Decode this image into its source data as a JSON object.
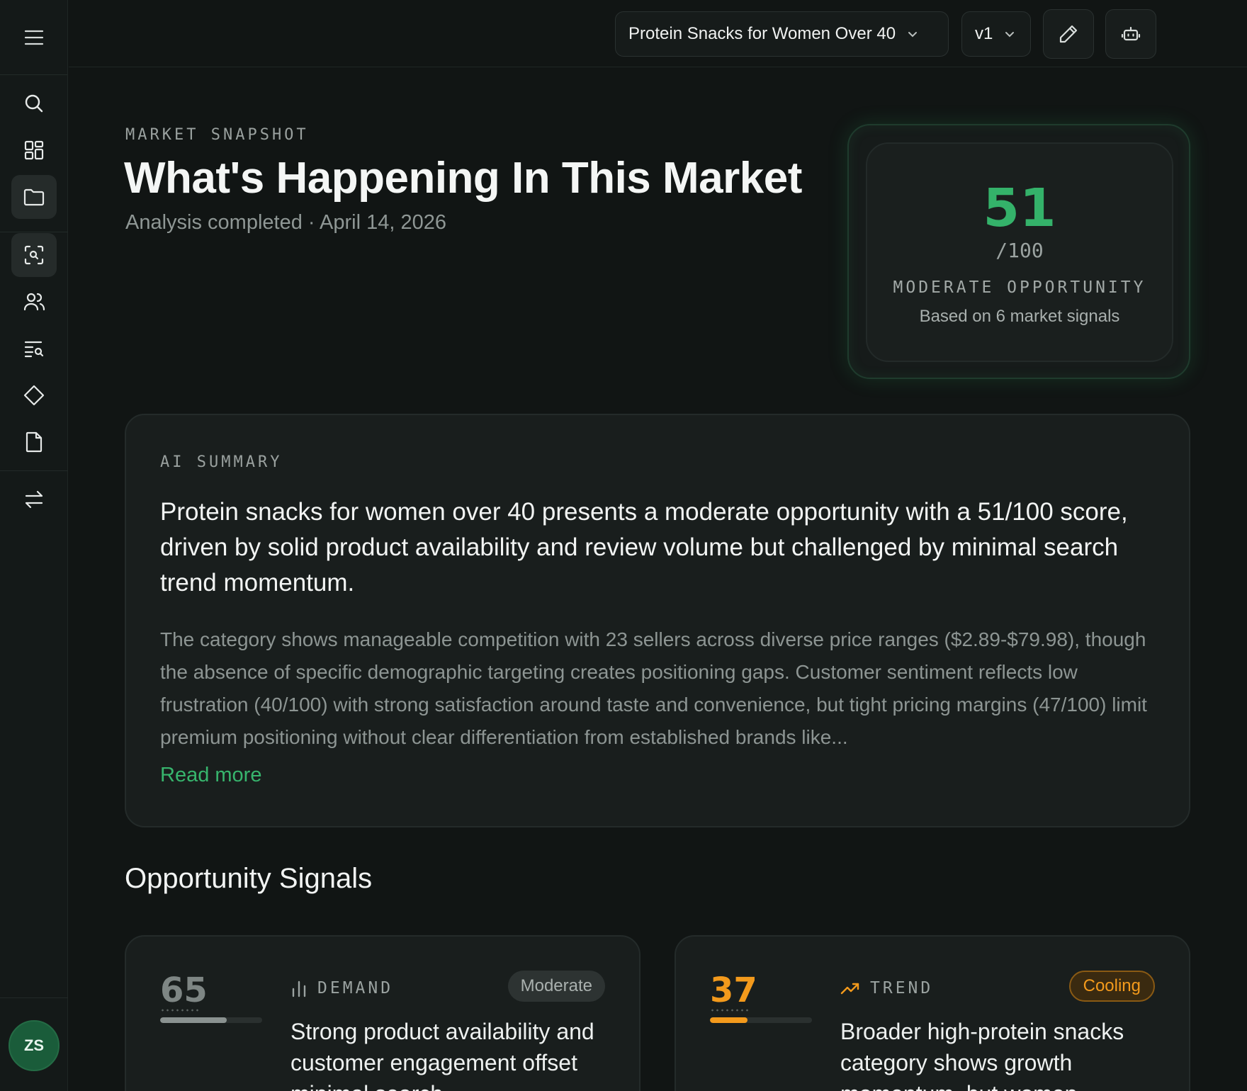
{
  "topbar": {
    "project_select": "Protein Snacks for Women Over 40",
    "version_select": "v1"
  },
  "sidebar": {
    "items": [
      {
        "icon": "search-icon"
      },
      {
        "icon": "grid-icon"
      },
      {
        "icon": "folder-icon"
      },
      {
        "icon": "scan-search-icon"
      },
      {
        "icon": "users-icon"
      },
      {
        "icon": "list-search-icon"
      },
      {
        "icon": "diamond-icon"
      },
      {
        "icon": "file-icon"
      },
      {
        "icon": "swap-icon"
      }
    ],
    "avatar_initials": "ZS"
  },
  "header": {
    "eyebrow": "MARKET SNAPSHOT",
    "title": "What's Happening In This Market",
    "subtitle": "Analysis completed · April 14, 2026"
  },
  "score": {
    "value": "51",
    "denominator": "/100",
    "label": "MODERATE OPPORTUNITY",
    "note": "Based on 6 market signals"
  },
  "summary": {
    "eyebrow": "AI SUMMARY",
    "headline": "Protein snacks for women over 40 presents a moderate opportunity with a 51/100 score, driven by solid product availability and review volume but challenged by minimal search trend momentum.",
    "body": "The category shows manageable competition with 23 sellers across diverse price ranges ($2.89-$79.98), though the absence of specific demographic targeting creates positioning gaps. Customer sentiment reflects low frustration (40/100) with strong satisfaction around taste and convenience, but tight pricing margins (47/100) limit premium positioning without clear differentiation from established brands like...",
    "read_more": "Read more"
  },
  "signals": {
    "title": "Opportunity Signals",
    "cards": [
      {
        "score": "65",
        "fill_percent": 65,
        "category": "DEMAND",
        "badge": "Moderate",
        "text": "Strong product availability and customer engagement offset minimal search",
        "color": "#7e8684"
      },
      {
        "score": "37",
        "fill_percent": 37,
        "category": "TREND",
        "badge": "Cooling",
        "text": "Broader high-protein snacks category shows growth momentum, but women",
        "color": "#f39a1c"
      }
    ]
  },
  "colors": {
    "accent_green": "#34b26a",
    "warning_orange": "#f39a1c",
    "background": "#111514"
  }
}
